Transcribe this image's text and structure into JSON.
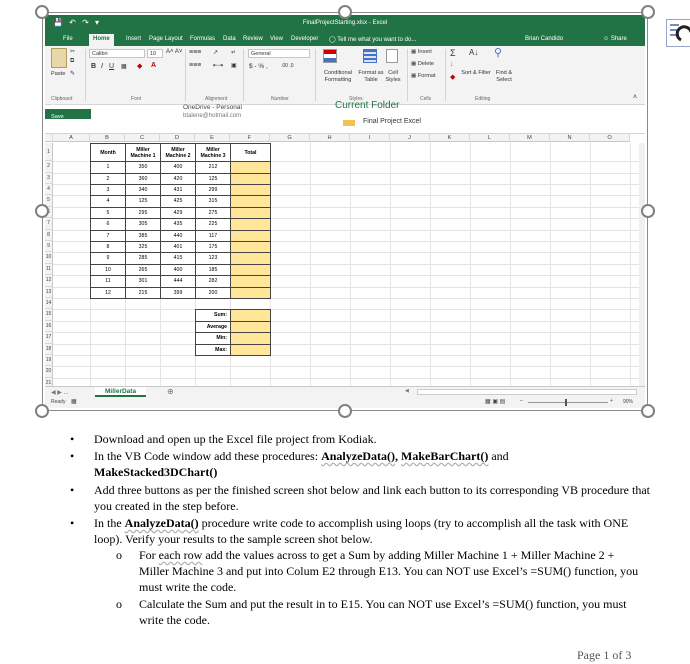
{
  "excel": {
    "title": "FinalProjectStarting.xlsx - Excel",
    "tabs": [
      "File",
      "Home",
      "Insert",
      "Page Layout",
      "Formulas",
      "Data",
      "Review",
      "View",
      "Developer"
    ],
    "tell_me": "Tell me what you want to do...",
    "user": "Brian Candido",
    "share": "Share",
    "ribbon": {
      "paste": "Paste",
      "font_name": "Calibri",
      "font_size": "10",
      "number_format": "General",
      "conditional_formatting": "Conditional Formatting",
      "format_as_table": "Format as Table",
      "cell_styles": "Cell Styles",
      "insert": "Insert",
      "delete": "Delete",
      "format": "Format",
      "sort_filter": "Sort & Filter",
      "find_select": "Find & Select",
      "group_labels": [
        "Clipboard",
        "Font",
        "Alignment",
        "Number",
        "Styles",
        "Cells",
        "Editing"
      ]
    },
    "overlay": {
      "open": "Open",
      "save": "Save",
      "onedrive": "OneDrive - Personal",
      "email": "btalene@hotmail.com",
      "current_folder": "Current Folder",
      "final_project": "Final Project Excel"
    },
    "columns": [
      "A",
      "B",
      "C",
      "D",
      "E",
      "F",
      "G",
      "H",
      "I",
      "J",
      "K",
      "L",
      "M",
      "N",
      "O"
    ],
    "rows": [
      "1",
      "2",
      "3",
      "4",
      "5",
      "6",
      "7",
      "8",
      "9",
      "10",
      "11",
      "12",
      "13",
      "14",
      "15",
      "16",
      "17",
      "18",
      "19",
      "20",
      "21"
    ],
    "table": {
      "headers": [
        "Month",
        "Miller Machine 1",
        "Miller Machine 2",
        "Miller Machine 3",
        "Total"
      ],
      "data": [
        [
          "1",
          "350",
          "400",
          "212"
        ],
        [
          "2",
          "360",
          "420",
          "125"
        ],
        [
          "3",
          "340",
          "431",
          "299"
        ],
        [
          "4",
          "125",
          "425",
          "315"
        ],
        [
          "5",
          "295",
          "429",
          "275"
        ],
        [
          "6",
          "305",
          "435",
          "225"
        ],
        [
          "7",
          "385",
          "440",
          "117"
        ],
        [
          "8",
          "325",
          "401",
          "175"
        ],
        [
          "9",
          "285",
          "415",
          "123"
        ],
        [
          "10",
          "265",
          "400",
          "185"
        ],
        [
          "11",
          "301",
          "444",
          "282"
        ],
        [
          "12",
          "215",
          "399",
          "200"
        ]
      ],
      "summary_labels": [
        "Sum:",
        "Average",
        "Min:",
        "Max:"
      ]
    },
    "sheet_tab": "MillerData",
    "status": "Ready",
    "zoom": "90%"
  },
  "document": {
    "bullets": [
      "Download and open up the Excel file project from Kodiak.",
      "Add three buttons as per the finished screen shot below and link each button to its corresponding VB procedure that you created in the step before."
    ],
    "bullet2_pre": "In the VB Code window add these procedures: ",
    "bullet2_p1": "AnalyzeData()",
    "bullet2_sep1": ", ",
    "bullet2_p2": "MakeBarChart()",
    "bullet2_mid": " and",
    "bullet2_p3": "MakeStacked3DChart()",
    "bullet4_pre": "In the ",
    "bullet4_p": "AnalyzeData()",
    "bullet4_post": " procedure write code to accomplish using loops (try to accomplish all the task with ONE loop).  Verify your results to the sample screen shot below.",
    "sub1_pre": "For ",
    "sub1_each": "each row",
    "sub1_post": " add the values across to get a Sum by adding Miller Machine 1 + Miller Machine 2 + Miller Machine 3 and put into Colum E2 through E13.  You can NOT use Excel’s =SUM() function, you must write the code.",
    "sub2": "Calculate the Sum and put the result in to E15. You can NOT use Excel’s =SUM() function, you must write the code.",
    "page_number": "Page 1 of 3"
  }
}
